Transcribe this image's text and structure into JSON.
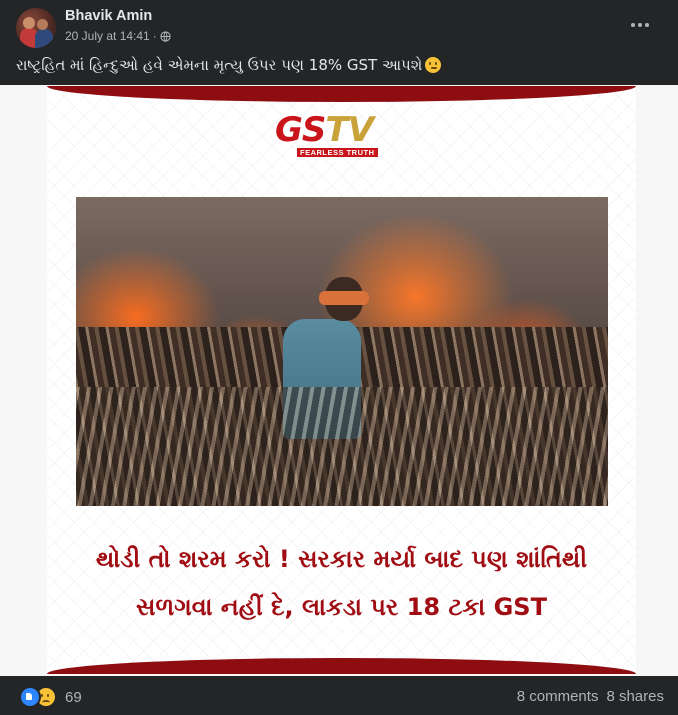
{
  "post": {
    "author": "Bhavik Amin",
    "date": "20 July at 14:41",
    "separator": "·",
    "privacy_icon": "globe-icon",
    "more_icon": "ellipsis-icon",
    "caption": "રાષ્ટ્રહિત માં હિન્દુઓ હવે એમના મૃત્યુ ઉપર પણ 18% GST આપશે",
    "caption_emoji": "thinking-face-emoji"
  },
  "image": {
    "logo_gs": "GS",
    "logo_tv": "TV",
    "logo_tagline": "FEARLESS TRUTH",
    "headline_line1": "થોડી તો શરમ કરો ! સરકાર મર્યા બાદ પણ શાંતિથી",
    "headline_line2": "સળગવા નહીં દે, લાકડા પર 18 ટકા GST"
  },
  "footer": {
    "reactions": [
      "like",
      "sad"
    ],
    "reaction_count": "69",
    "comments": "8 comments",
    "shares": "8 shares"
  },
  "colors": {
    "background": "#242526",
    "brand_red": "#8e0d10",
    "headline_red": "#a00d12",
    "logo_gold": "#c9a23a",
    "like_blue": "#2d86ff"
  }
}
